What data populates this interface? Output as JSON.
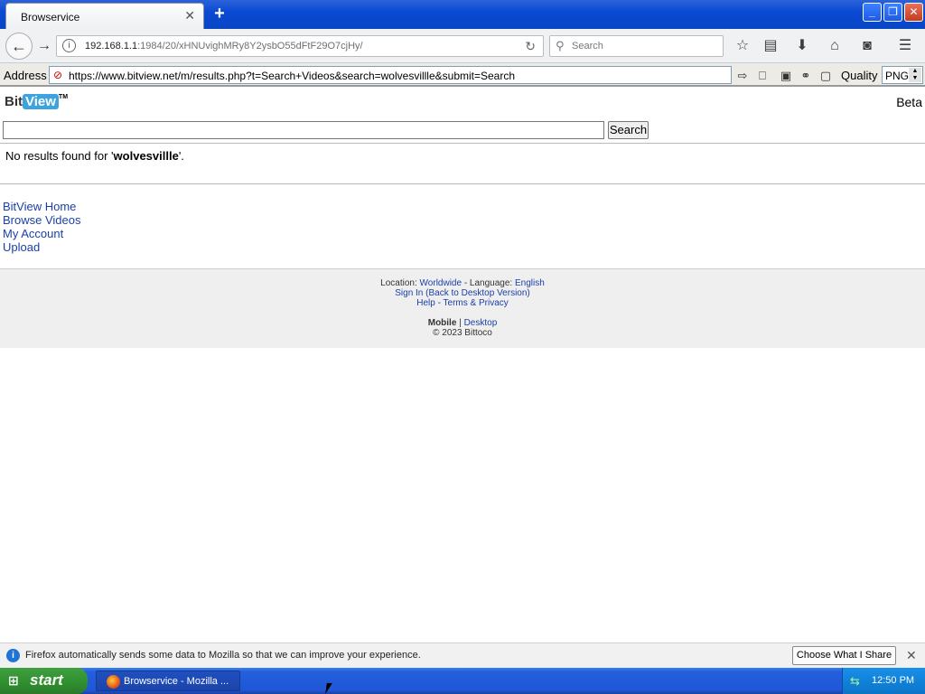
{
  "browser": {
    "tab_title": "Browservice",
    "url_host": "192.168.1.1",
    "url_path": ":1984/20/xHNUvighMRy8Y2ysbO55dFtF29O7cjHy/",
    "search_placeholder": "Search"
  },
  "address_bar": {
    "label": "Address",
    "url": "https://www.bitview.net/m/results.php?t=Search+Videos&search=wolvesvillle&submit=Search",
    "quality_label": "Quality",
    "quality_value": "PNG"
  },
  "page": {
    "logo_bit": "Bit",
    "logo_view": "View",
    "logo_tm": "TM",
    "beta": "Beta",
    "search_value": "",
    "search_button": "Search",
    "no_results_prefix": "No results found for '",
    "no_results_query": "wolvesvillle",
    "no_results_suffix": "'.",
    "nav_links": [
      "BitView Home",
      "Browse Videos",
      "My Account",
      "Upload"
    ],
    "footer": {
      "location_label": "Location:",
      "location_value": "Worldwide",
      "language_label": "- Language:",
      "language_value": "English",
      "sign_in": "Sign In (Back to Desktop Version)",
      "help": "Help",
      "sep": "-",
      "terms": "Terms & Privacy",
      "mobile": "Mobile",
      "pipe": "|",
      "desktop": "Desktop",
      "copyright": "© 2023 Bittoco"
    }
  },
  "notification": {
    "message": "Firefox automatically sends some data to Mozilla so that we can improve your experience.",
    "button": "Choose What I Share"
  },
  "taskbar": {
    "start": "start",
    "task_label": "Browservice - Mozilla ...",
    "clock": "12:50 PM"
  },
  "colors": {
    "link": "#1b3fa6",
    "xp_blue": "#245edb",
    "start_green": "#3fa03f"
  }
}
